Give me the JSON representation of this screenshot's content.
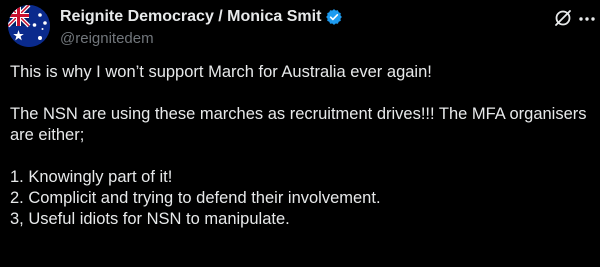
{
  "user": {
    "display_name": "Reignite Democracy / Monica Smit",
    "handle": "@reignitedem",
    "verified": true,
    "avatar": "australian-flag-avatar"
  },
  "icons": {
    "grok": "grok-icon",
    "more": "more-options-icon",
    "verified": "verified-badge-icon"
  },
  "colors": {
    "background": "#000000",
    "text": "#e7e9ea",
    "muted": "#71767b",
    "verified_blue": "#1d9bf0"
  },
  "post": {
    "line_1": "This is why I won’t support March for Australia ever again!",
    "paragraph_2": "The NSN are using these marches as recruitment drives!!! The MFA organisers are either;",
    "list": [
      "1. Knowingly part of it!",
      "2. Complicit and trying to defend their involvement.",
      "3, Useful idiots for NSN to manipulate."
    ]
  }
}
